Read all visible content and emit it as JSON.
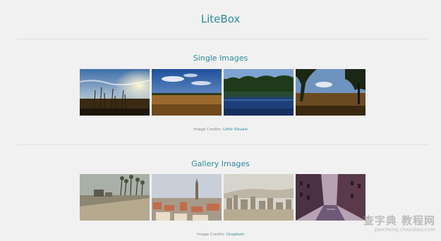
{
  "site": {
    "title": "LiteBox"
  },
  "single_section": {
    "title": "Single Images",
    "thumbs": [
      "field-sunset-image",
      "meadow-sky-image",
      "lake-reflection-image",
      "tree-field-image"
    ],
    "credits_label": "Image Credits:",
    "credits_link": "Little Visuals"
  },
  "gallery_section": {
    "title": "Gallery Images",
    "thumbs": [
      "beach-palms-image",
      "city-rooftops-image",
      "city-skyline-image",
      "canal-street-image"
    ],
    "credits_label": "Image Credits:",
    "credits_link": "Unsplash"
  },
  "watermark": {
    "main": "查字典 教程网",
    "sub": "jiaocheng.chazidian.com"
  },
  "colors": {
    "accent": "#2b8a9c",
    "background": "#f1f1f1"
  }
}
